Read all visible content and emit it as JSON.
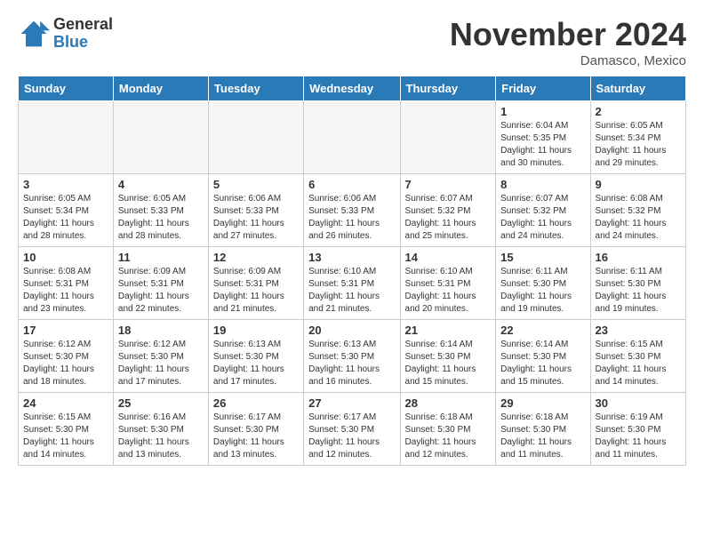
{
  "header": {
    "logo_general": "General",
    "logo_blue": "Blue",
    "month_title": "November 2024",
    "location": "Damasco, Mexico"
  },
  "days_of_week": [
    "Sunday",
    "Monday",
    "Tuesday",
    "Wednesday",
    "Thursday",
    "Friday",
    "Saturday"
  ],
  "weeks": [
    [
      {
        "day": "",
        "info": ""
      },
      {
        "day": "",
        "info": ""
      },
      {
        "day": "",
        "info": ""
      },
      {
        "day": "",
        "info": ""
      },
      {
        "day": "",
        "info": ""
      },
      {
        "day": "1",
        "info": "Sunrise: 6:04 AM\nSunset: 5:35 PM\nDaylight: 11 hours\nand 30 minutes."
      },
      {
        "day": "2",
        "info": "Sunrise: 6:05 AM\nSunset: 5:34 PM\nDaylight: 11 hours\nand 29 minutes."
      }
    ],
    [
      {
        "day": "3",
        "info": "Sunrise: 6:05 AM\nSunset: 5:34 PM\nDaylight: 11 hours\nand 28 minutes."
      },
      {
        "day": "4",
        "info": "Sunrise: 6:05 AM\nSunset: 5:33 PM\nDaylight: 11 hours\nand 28 minutes."
      },
      {
        "day": "5",
        "info": "Sunrise: 6:06 AM\nSunset: 5:33 PM\nDaylight: 11 hours\nand 27 minutes."
      },
      {
        "day": "6",
        "info": "Sunrise: 6:06 AM\nSunset: 5:33 PM\nDaylight: 11 hours\nand 26 minutes."
      },
      {
        "day": "7",
        "info": "Sunrise: 6:07 AM\nSunset: 5:32 PM\nDaylight: 11 hours\nand 25 minutes."
      },
      {
        "day": "8",
        "info": "Sunrise: 6:07 AM\nSunset: 5:32 PM\nDaylight: 11 hours\nand 24 minutes."
      },
      {
        "day": "9",
        "info": "Sunrise: 6:08 AM\nSunset: 5:32 PM\nDaylight: 11 hours\nand 24 minutes."
      }
    ],
    [
      {
        "day": "10",
        "info": "Sunrise: 6:08 AM\nSunset: 5:31 PM\nDaylight: 11 hours\nand 23 minutes."
      },
      {
        "day": "11",
        "info": "Sunrise: 6:09 AM\nSunset: 5:31 PM\nDaylight: 11 hours\nand 22 minutes."
      },
      {
        "day": "12",
        "info": "Sunrise: 6:09 AM\nSunset: 5:31 PM\nDaylight: 11 hours\nand 21 minutes."
      },
      {
        "day": "13",
        "info": "Sunrise: 6:10 AM\nSunset: 5:31 PM\nDaylight: 11 hours\nand 21 minutes."
      },
      {
        "day": "14",
        "info": "Sunrise: 6:10 AM\nSunset: 5:31 PM\nDaylight: 11 hours\nand 20 minutes."
      },
      {
        "day": "15",
        "info": "Sunrise: 6:11 AM\nSunset: 5:30 PM\nDaylight: 11 hours\nand 19 minutes."
      },
      {
        "day": "16",
        "info": "Sunrise: 6:11 AM\nSunset: 5:30 PM\nDaylight: 11 hours\nand 19 minutes."
      }
    ],
    [
      {
        "day": "17",
        "info": "Sunrise: 6:12 AM\nSunset: 5:30 PM\nDaylight: 11 hours\nand 18 minutes."
      },
      {
        "day": "18",
        "info": "Sunrise: 6:12 AM\nSunset: 5:30 PM\nDaylight: 11 hours\nand 17 minutes."
      },
      {
        "day": "19",
        "info": "Sunrise: 6:13 AM\nSunset: 5:30 PM\nDaylight: 11 hours\nand 17 minutes."
      },
      {
        "day": "20",
        "info": "Sunrise: 6:13 AM\nSunset: 5:30 PM\nDaylight: 11 hours\nand 16 minutes."
      },
      {
        "day": "21",
        "info": "Sunrise: 6:14 AM\nSunset: 5:30 PM\nDaylight: 11 hours\nand 15 minutes."
      },
      {
        "day": "22",
        "info": "Sunrise: 6:14 AM\nSunset: 5:30 PM\nDaylight: 11 hours\nand 15 minutes."
      },
      {
        "day": "23",
        "info": "Sunrise: 6:15 AM\nSunset: 5:30 PM\nDaylight: 11 hours\nand 14 minutes."
      }
    ],
    [
      {
        "day": "24",
        "info": "Sunrise: 6:15 AM\nSunset: 5:30 PM\nDaylight: 11 hours\nand 14 minutes."
      },
      {
        "day": "25",
        "info": "Sunrise: 6:16 AM\nSunset: 5:30 PM\nDaylight: 11 hours\nand 13 minutes."
      },
      {
        "day": "26",
        "info": "Sunrise: 6:17 AM\nSunset: 5:30 PM\nDaylight: 11 hours\nand 13 minutes."
      },
      {
        "day": "27",
        "info": "Sunrise: 6:17 AM\nSunset: 5:30 PM\nDaylight: 11 hours\nand 12 minutes."
      },
      {
        "day": "28",
        "info": "Sunrise: 6:18 AM\nSunset: 5:30 PM\nDaylight: 11 hours\nand 12 minutes."
      },
      {
        "day": "29",
        "info": "Sunrise: 6:18 AM\nSunset: 5:30 PM\nDaylight: 11 hours\nand 11 minutes."
      },
      {
        "day": "30",
        "info": "Sunrise: 6:19 AM\nSunset: 5:30 PM\nDaylight: 11 hours\nand 11 minutes."
      }
    ]
  ]
}
